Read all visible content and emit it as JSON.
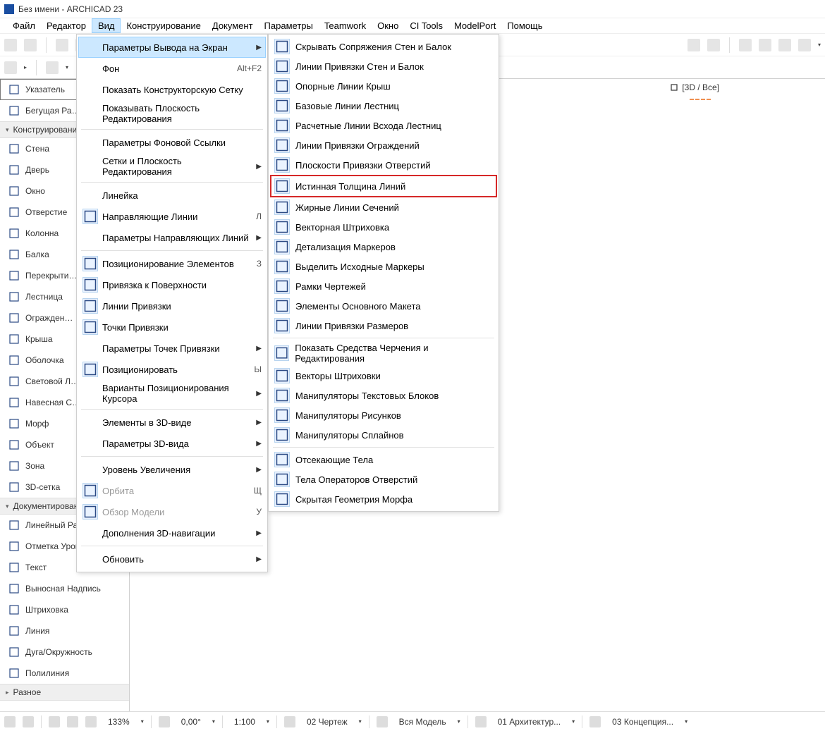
{
  "title": "Без имени - ARCHICAD 23",
  "menubar": [
    "Файл",
    "Редактор",
    "Вид",
    "Конструирование",
    "Документ",
    "Параметры",
    "Teamwork",
    "Окно",
    "CI Tools",
    "ModelPort",
    "Помощь"
  ],
  "menubar_active_index": 2,
  "sidebar": {
    "groups": [
      {
        "label": "",
        "items": [
          {
            "label": "Указатель",
            "selected": true
          },
          {
            "label": "Бегущая Ра…"
          }
        ]
      },
      {
        "label": "Конструировани…",
        "items": [
          {
            "label": "Стена"
          },
          {
            "label": "Дверь"
          },
          {
            "label": "Окно"
          },
          {
            "label": "Отверстие"
          },
          {
            "label": "Колонна"
          },
          {
            "label": "Балка"
          },
          {
            "label": "Перекрыти…"
          },
          {
            "label": "Лестница"
          },
          {
            "label": "Огражден…"
          },
          {
            "label": "Крыша"
          },
          {
            "label": "Оболочка"
          },
          {
            "label": "Световой Л…"
          },
          {
            "label": "Навесная С…"
          },
          {
            "label": "Морф"
          },
          {
            "label": "Объект"
          },
          {
            "label": "Зона"
          },
          {
            "label": "3D-сетка"
          }
        ]
      },
      {
        "label": "Документирование",
        "items": [
          {
            "label": "Линейный Размер"
          },
          {
            "label": "Отметка Уровня"
          },
          {
            "label": "Текст"
          },
          {
            "label": "Выносная Надпись"
          },
          {
            "label": "Штриховка"
          },
          {
            "label": "Линия"
          },
          {
            "label": "Дуга/Окружность"
          },
          {
            "label": "Полилиния"
          }
        ]
      },
      {
        "label": "Разное",
        "items": []
      }
    ]
  },
  "view_menu": [
    {
      "label": "Параметры Вывода на Экран",
      "highlight": true,
      "submenu": true
    },
    {
      "label": "Фон",
      "shortcut": "Alt+F2"
    },
    {
      "label": "Показать Конструкторскую Сетку"
    },
    {
      "label": "Показывать Плоскость Редактирования"
    },
    "sep",
    {
      "label": "Параметры Фоновой Ссылки"
    },
    {
      "label": "Сетки и Плоскость Редактирования",
      "submenu": true
    },
    "sep",
    {
      "label": "Линейка"
    },
    {
      "label": "Направляющие Линии",
      "shortcut": "Л",
      "icon": true
    },
    {
      "label": "Параметры Направляющих Линий",
      "submenu": true
    },
    "sep",
    {
      "label": "Позиционирование Элементов",
      "shortcut": "З",
      "icon": true
    },
    {
      "label": "Привязка к Поверхности",
      "icon": true
    },
    {
      "label": "Линии Привязки",
      "icon": true
    },
    {
      "label": "Точки Привязки",
      "icon": true
    },
    {
      "label": "Параметры Точек Привязки",
      "submenu": true
    },
    {
      "label": "Позиционировать",
      "shortcut": "Ы",
      "icon": true
    },
    {
      "label": "Варианты Позиционирования Курсора",
      "submenu": true
    },
    "sep",
    {
      "label": "Элементы в 3D-виде",
      "submenu": true
    },
    {
      "label": "Параметры 3D-вида",
      "submenu": true
    },
    "sep",
    {
      "label": "Уровень Увеличения",
      "submenu": true
    },
    {
      "label": "Орбита",
      "shortcut": "Щ",
      "disabled": true,
      "icon": true
    },
    {
      "label": "Обзор Модели",
      "shortcut": "У",
      "disabled": true,
      "icon": true
    },
    {
      "label": "Дополнения 3D-навигации",
      "submenu": true
    },
    "sep",
    {
      "label": "Обновить",
      "submenu": true
    }
  ],
  "display_submenu": [
    {
      "label": "Скрывать Сопряжения Стен и Балок"
    },
    {
      "label": "Линии Привязки Стен и Балок"
    },
    {
      "label": "Опорные Линии Крыш"
    },
    {
      "label": "Базовые Линии Лестниц"
    },
    {
      "label": "Расчетные Линии Всхода Лестниц"
    },
    {
      "label": "Линии Привязки Ограждений"
    },
    {
      "label": "Плоскости Привязки Отверстий"
    },
    {
      "label": "Истинная Толщина Линий",
      "hl": true
    },
    {
      "label": "Жирные Линии Сечений"
    },
    {
      "label": "Векторная Штриховка"
    },
    {
      "label": "Детализация Маркеров"
    },
    {
      "label": "Выделить Исходные Маркеры"
    },
    {
      "label": "Рамки Чертежей"
    },
    {
      "label": "Элементы Основного Макета"
    },
    {
      "label": "Линии Привязки Размеров"
    },
    "sep",
    {
      "label": "Показать Средства Черчения и Редактирования"
    },
    {
      "label": "Векторы Штриховки"
    },
    {
      "label": "Манипуляторы Текстовых Блоков"
    },
    {
      "label": "Манипуляторы Рисунков"
    },
    {
      "label": "Манипуляторы Сплайнов"
    },
    "sep",
    {
      "label": "Отсекающие Тела"
    },
    {
      "label": "Тела Операторов Отверстий"
    },
    {
      "label": "Скрытая Геометрия Морфа"
    }
  ],
  "tag_3d": "[3D / Все]",
  "statusbar": {
    "zoom": "133%",
    "angle": "0,00°",
    "scale": "1:100",
    "draft": "02 Чертеж",
    "model": "Вся Модель",
    "arch": "01 Архитектур...",
    "concept": "03 Концепция..."
  }
}
